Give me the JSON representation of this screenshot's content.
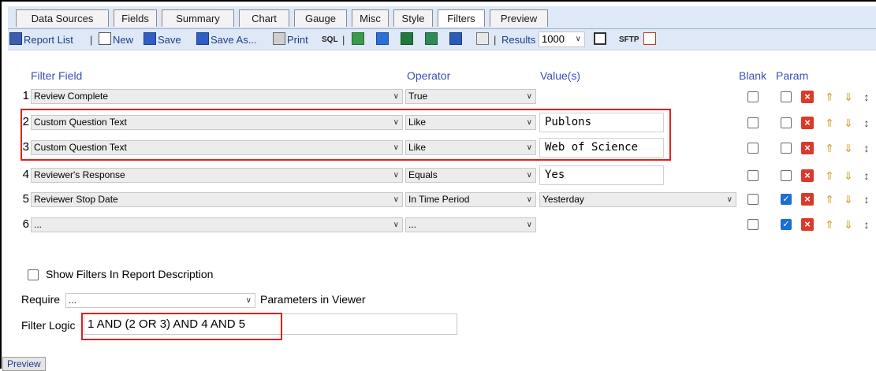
{
  "tabs": [
    "Data Sources",
    "Fields",
    "Summary",
    "Chart",
    "Gauge",
    "Misc",
    "Style",
    "Filters",
    "Preview"
  ],
  "active_tab": "Filters",
  "toolbar": {
    "report_list": "Report List",
    "new": "New",
    "save": "Save",
    "save_as": "Save As...",
    "print": "Print",
    "sql": "SQL",
    "results_label": "Results",
    "results_value": "1000",
    "sftp": "SFTP",
    "separator": "|"
  },
  "headers": {
    "filter_field": "Filter Field",
    "operator": "Operator",
    "values": "Value(s)",
    "blank": "Blank",
    "param": "Param"
  },
  "rows": [
    {
      "num": "1",
      "field": "Review Complete",
      "operator": "True",
      "value": "",
      "value_type": "none",
      "param": false
    },
    {
      "num": "2",
      "field": "Custom Question Text",
      "operator": "Like",
      "value": "Publons",
      "value_type": "text",
      "param": false
    },
    {
      "num": "3",
      "field": "Custom Question Text",
      "operator": "Like",
      "value": "Web of Science",
      "value_type": "text",
      "param": false
    },
    {
      "num": "4",
      "field": "Reviewer's Response",
      "operator": "Equals",
      "value": "Yes",
      "value_type": "text",
      "param": false
    },
    {
      "num": "5",
      "field": "Reviewer Stop Date",
      "operator": "In Time Period",
      "value": "Yesterday",
      "value_type": "select",
      "param": true
    },
    {
      "num": "6",
      "field": "...",
      "operator": "...",
      "value": "",
      "value_type": "none",
      "param": true
    }
  ],
  "show_filters_label": "Show Filters In Report Description",
  "require": {
    "label": "Require",
    "value": "...",
    "suffix": "Parameters in Viewer"
  },
  "filter_logic": {
    "label": "Filter Logic",
    "value": "1 AND (2 OR 3) AND 4 AND 5"
  },
  "preview_button": "Preview",
  "colors": {
    "highlight": "#e0201b",
    "header_text": "#3a4fb8",
    "checkbox_checked": "#1a6fd1"
  }
}
